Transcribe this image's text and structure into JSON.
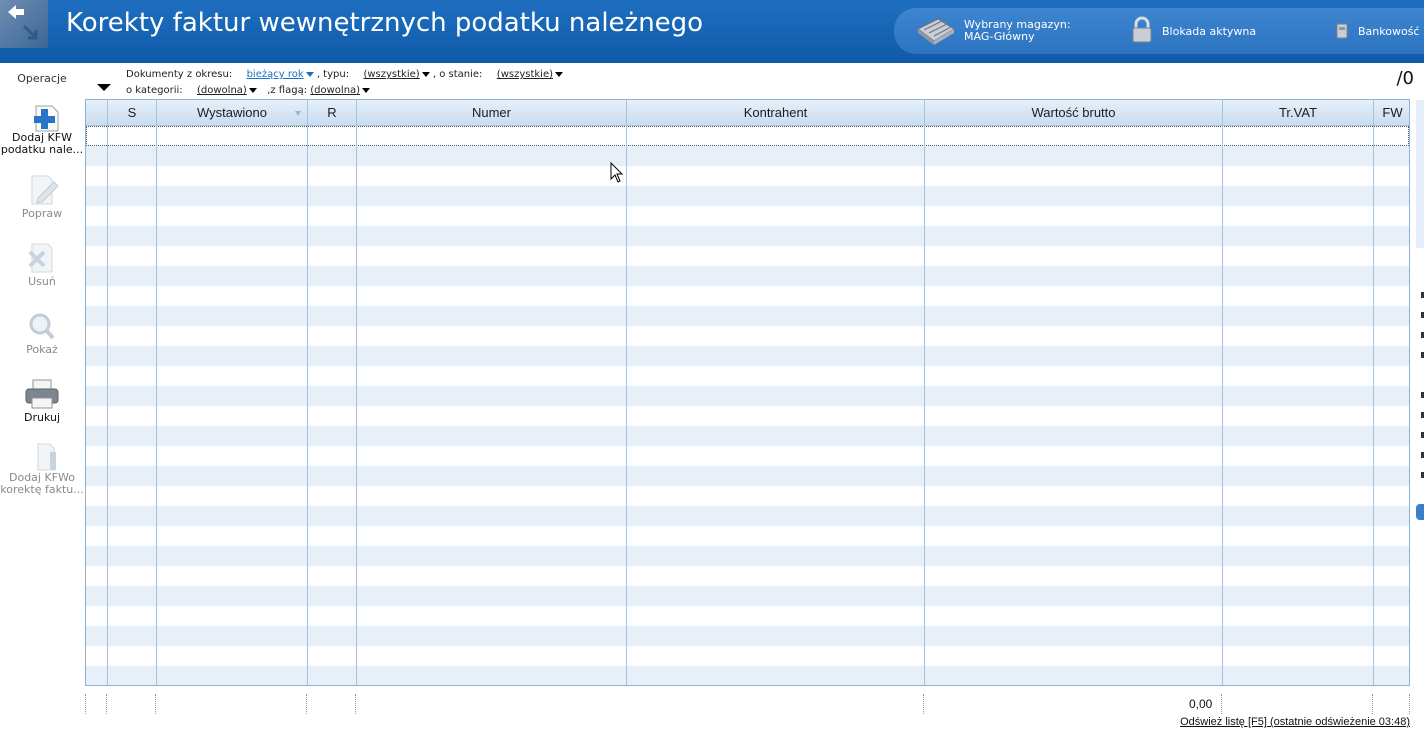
{
  "header": {
    "title": "Korekty faktur wewnętrznych podatku należnego",
    "status": {
      "warehouse_label": "Wybrany magazyn:",
      "warehouse_value": "MAG-Główny",
      "lock_label": "Blokada aktywna",
      "bank_label": "Bankowość"
    }
  },
  "sidebar": {
    "title": "Operacje",
    "items": [
      {
        "label1": "Dodaj KFW",
        "label2": "podatku nale..."
      },
      {
        "label1": "Popraw"
      },
      {
        "label1": "Usuń"
      },
      {
        "label1": "Pokaż"
      },
      {
        "label1": "Drukuj"
      },
      {
        "label1": "Dodaj KFWo",
        "label2": "korektę faktu..."
      }
    ]
  },
  "filters": {
    "period_label": "Dokumenty z okresu:",
    "period_value": "bieżący rok",
    "type_label": ", typu:",
    "type_value": "(wszystkie)",
    "state_label": ", o stanie:",
    "state_value": "(wszystkie)",
    "category_label": "o kategorii:",
    "category_value": "(dowolna)",
    "flag_label": ",z flagą:",
    "flag_value": "(dowolna)"
  },
  "count": "/0",
  "grid": {
    "columns": [
      "",
      "S",
      "Wystawiono",
      "R",
      "Numer",
      "Kontrahent",
      "Wartość brutto",
      "Tr.VAT",
      "FW"
    ]
  },
  "totals": {
    "brutto_sum": "0,00"
  },
  "refresh_link": "Odśwież listę [F5] (ostatnie odświeżenie 03:48)",
  "colors": {
    "header_blue": "#1468b8",
    "grid_stripe": "#e7f0f9",
    "link_blue": "#1a6fc2"
  }
}
